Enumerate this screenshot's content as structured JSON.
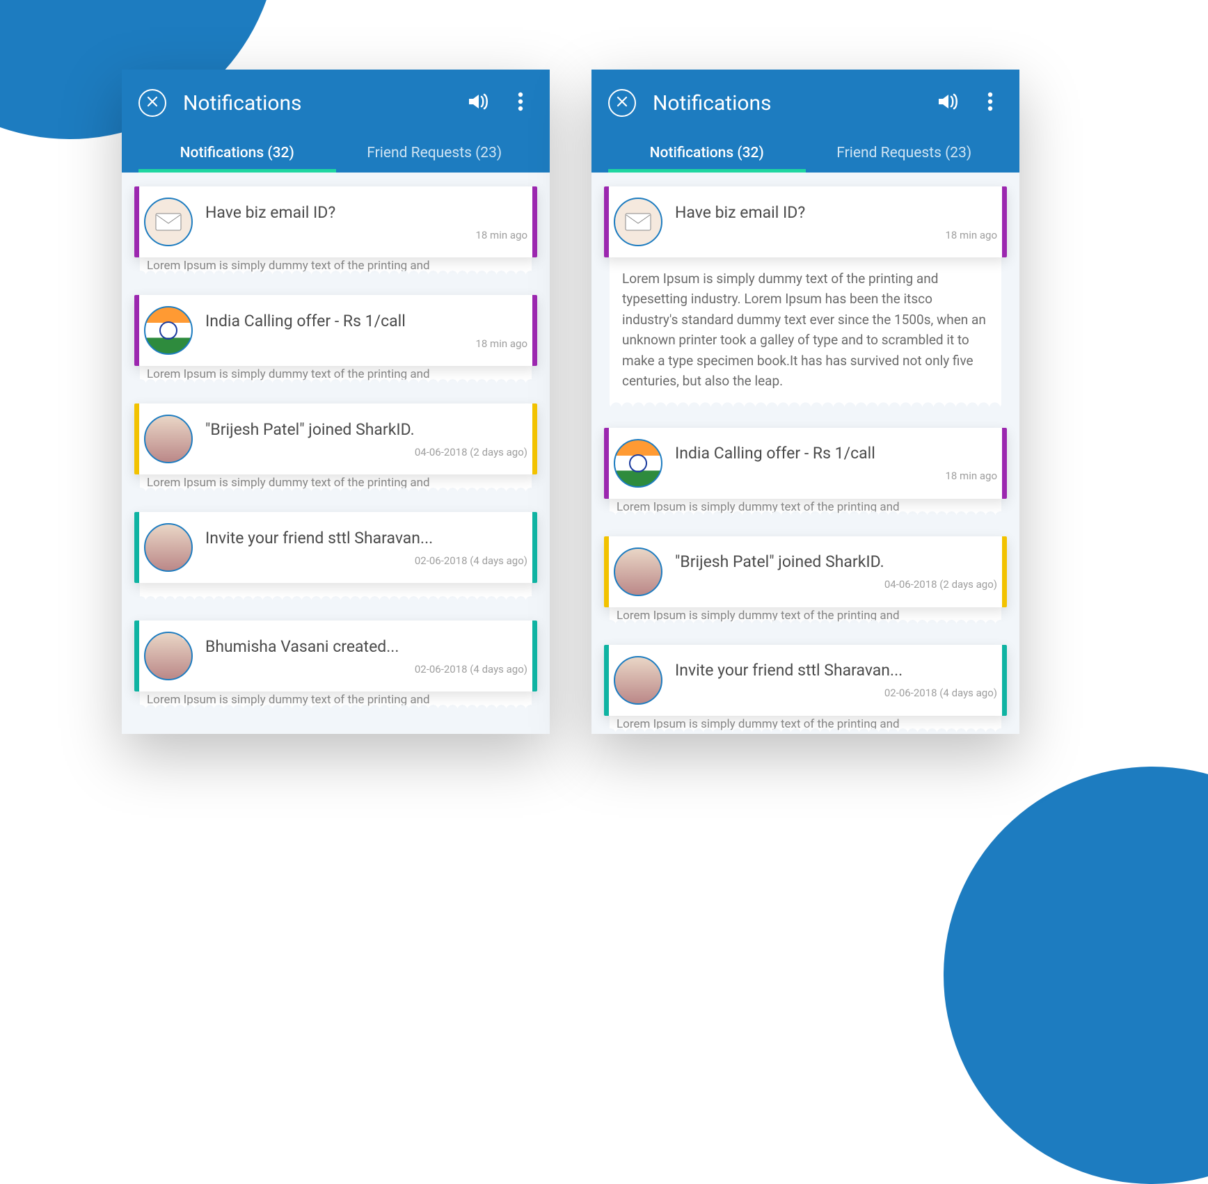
{
  "header": {
    "title": "Notifications"
  },
  "tabs": {
    "notifications": {
      "label": "Notifications (32)"
    },
    "requests": {
      "label": "Friend Requests (23)"
    }
  },
  "peek_text": "Lorem Ipsum is simply dummy text of the printing and",
  "expanded_body": "Lorem Ipsum is simply dummy text of the printing and typesetting industry. Lorem Ipsum has been the itsco industry's standard dummy text ever since the 1500s, when an unknown printer took a galley of type and to scrambled it to make a type specimen book.It has has survived not only five centuries, but also the leap.",
  "items": [
    {
      "title": "Have biz email ID?",
      "time": "18 min ago",
      "color": "purple",
      "avatar": "mail"
    },
    {
      "title": "India Calling offer - Rs 1/call",
      "time": "18 min ago",
      "color": "purple",
      "avatar": "flag"
    },
    {
      "title": "\"Brijesh Patel\" joined SharkID.",
      "time": "04-06-2018 (2 days ago)",
      "color": "yellow",
      "avatar": "person"
    },
    {
      "title": "Invite your friend sttl Sharavan...",
      "time": "02-06-2018 (4 days ago)",
      "color": "teal",
      "avatar": "person"
    },
    {
      "title": "Bhumisha Vasani created...",
      "time": "02-06-2018 (4 days ago)",
      "color": "teal",
      "avatar": "person"
    }
  ]
}
